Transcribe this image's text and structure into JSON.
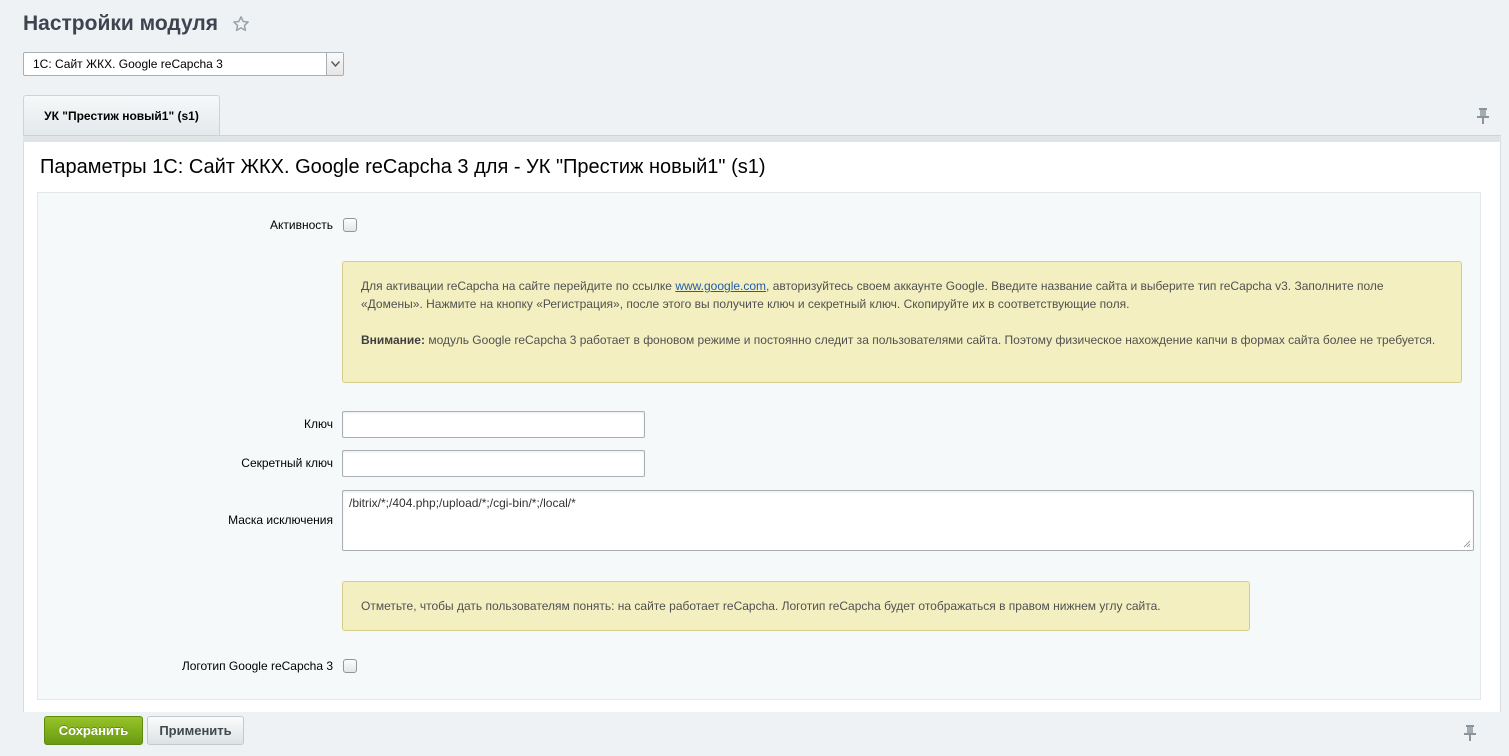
{
  "header": {
    "title": "Настройки модуля"
  },
  "module_select": {
    "selected": "1С: Сайт ЖКХ. Google reCapcha 3"
  },
  "tabs": [
    {
      "label": "УК \"Престиж новый1\" (s1)"
    }
  ],
  "section": {
    "title": "Параметры 1С: Сайт ЖКХ. Google reCapcha 3 для - УК \"Престиж новый1\" (s1)"
  },
  "form": {
    "active_label": "Активность",
    "info_note": {
      "text_before_link": "Для активации reCapcha на сайте перейдите по ссылке ",
      "link_text": "www.google.com",
      "text_after_link": ", авторизуйтесь своем аккаунте Google. Введите название сайта и выберите тип reCapcha v3. Заполните поле «Домены». Нажмите на кнопку «Регистрация», после этого вы получите ключ и секретный ключ. Скопируйте их в соответствующие поля.",
      "warning_bold": "Внимание:",
      "warning_text": " модуль Google reCapcha 3 работает в фоновом режиме и постоянно следит за пользователями сайта. Поэтому физическое нахождение капчи в формах сайта более не требуется."
    },
    "key_label": "Ключ",
    "key_value": "",
    "secret_label": "Секретный ключ",
    "secret_value": "",
    "mask_label": "Маска исключения",
    "mask_value": "/bitrix/*;/404.php;/upload/*;/cgi-bin/*;/local/*",
    "logo_note": "Отметьте, чтобы дать пользователям понять: на сайте работает reCapcha. Логотип reCapcha будет отображаться в правом нижнем углу сайта.",
    "logo_label": "Логотип Google reCapcha 3"
  },
  "buttons": {
    "save": "Сохранить",
    "apply": "Применить"
  },
  "icons": {
    "favorite": "star-icon",
    "pin_top": "pin-icon",
    "pin_bottom": "pin-icon",
    "select_arrow": "chevron-down-icon"
  },
  "colors": {
    "save_button": "#7aab1a",
    "note_background": "#f3efc1",
    "link": "#1f5da8"
  }
}
